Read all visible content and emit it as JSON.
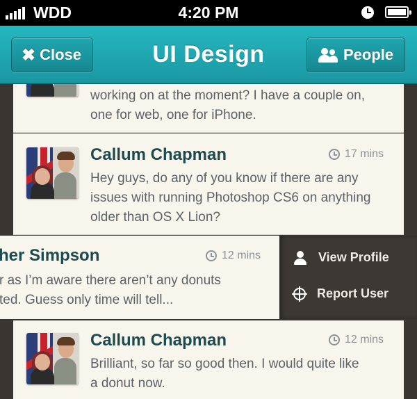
{
  "status_bar": {
    "carrier": "WDD",
    "time": "4:20 PM"
  },
  "nav": {
    "title": "UI Design",
    "close_label": "Close",
    "people_label": "People"
  },
  "messages": [
    {
      "lines": [
        "working on at the moment? I have a couple on,",
        "one for web, one for iPhone."
      ]
    },
    {
      "name": "Callum Chapman",
      "time": "17 mins",
      "lines": [
        "Hey guys, do any of you know if there are any",
        "issues with running Photoshop CS6 on anything",
        "older than OS X Lion?"
      ]
    },
    {
      "name": "her Simpson",
      "time": "12 mins",
      "lines": [
        "r as I’m aware there aren’t any donuts",
        "ted. Guess only time will tell..."
      ]
    },
    {
      "name": "Callum Chapman",
      "time": "12 mins",
      "lines": [
        "Brilliant, so far so good then. I would quite like",
        "a donut now."
      ]
    }
  ],
  "actions": {
    "view_profile": "View Profile",
    "report_user": "Report User"
  },
  "colors": {
    "nav": "#1fa6af",
    "card": "#f8f5ec",
    "name": "#1f4a4d",
    "panel": "#3e3834"
  },
  "icons": [
    "signal-icon",
    "alarm-icon",
    "battery-icon",
    "close-x-icon",
    "people-icon",
    "clock-icon",
    "user-icon",
    "report-target-icon"
  ]
}
